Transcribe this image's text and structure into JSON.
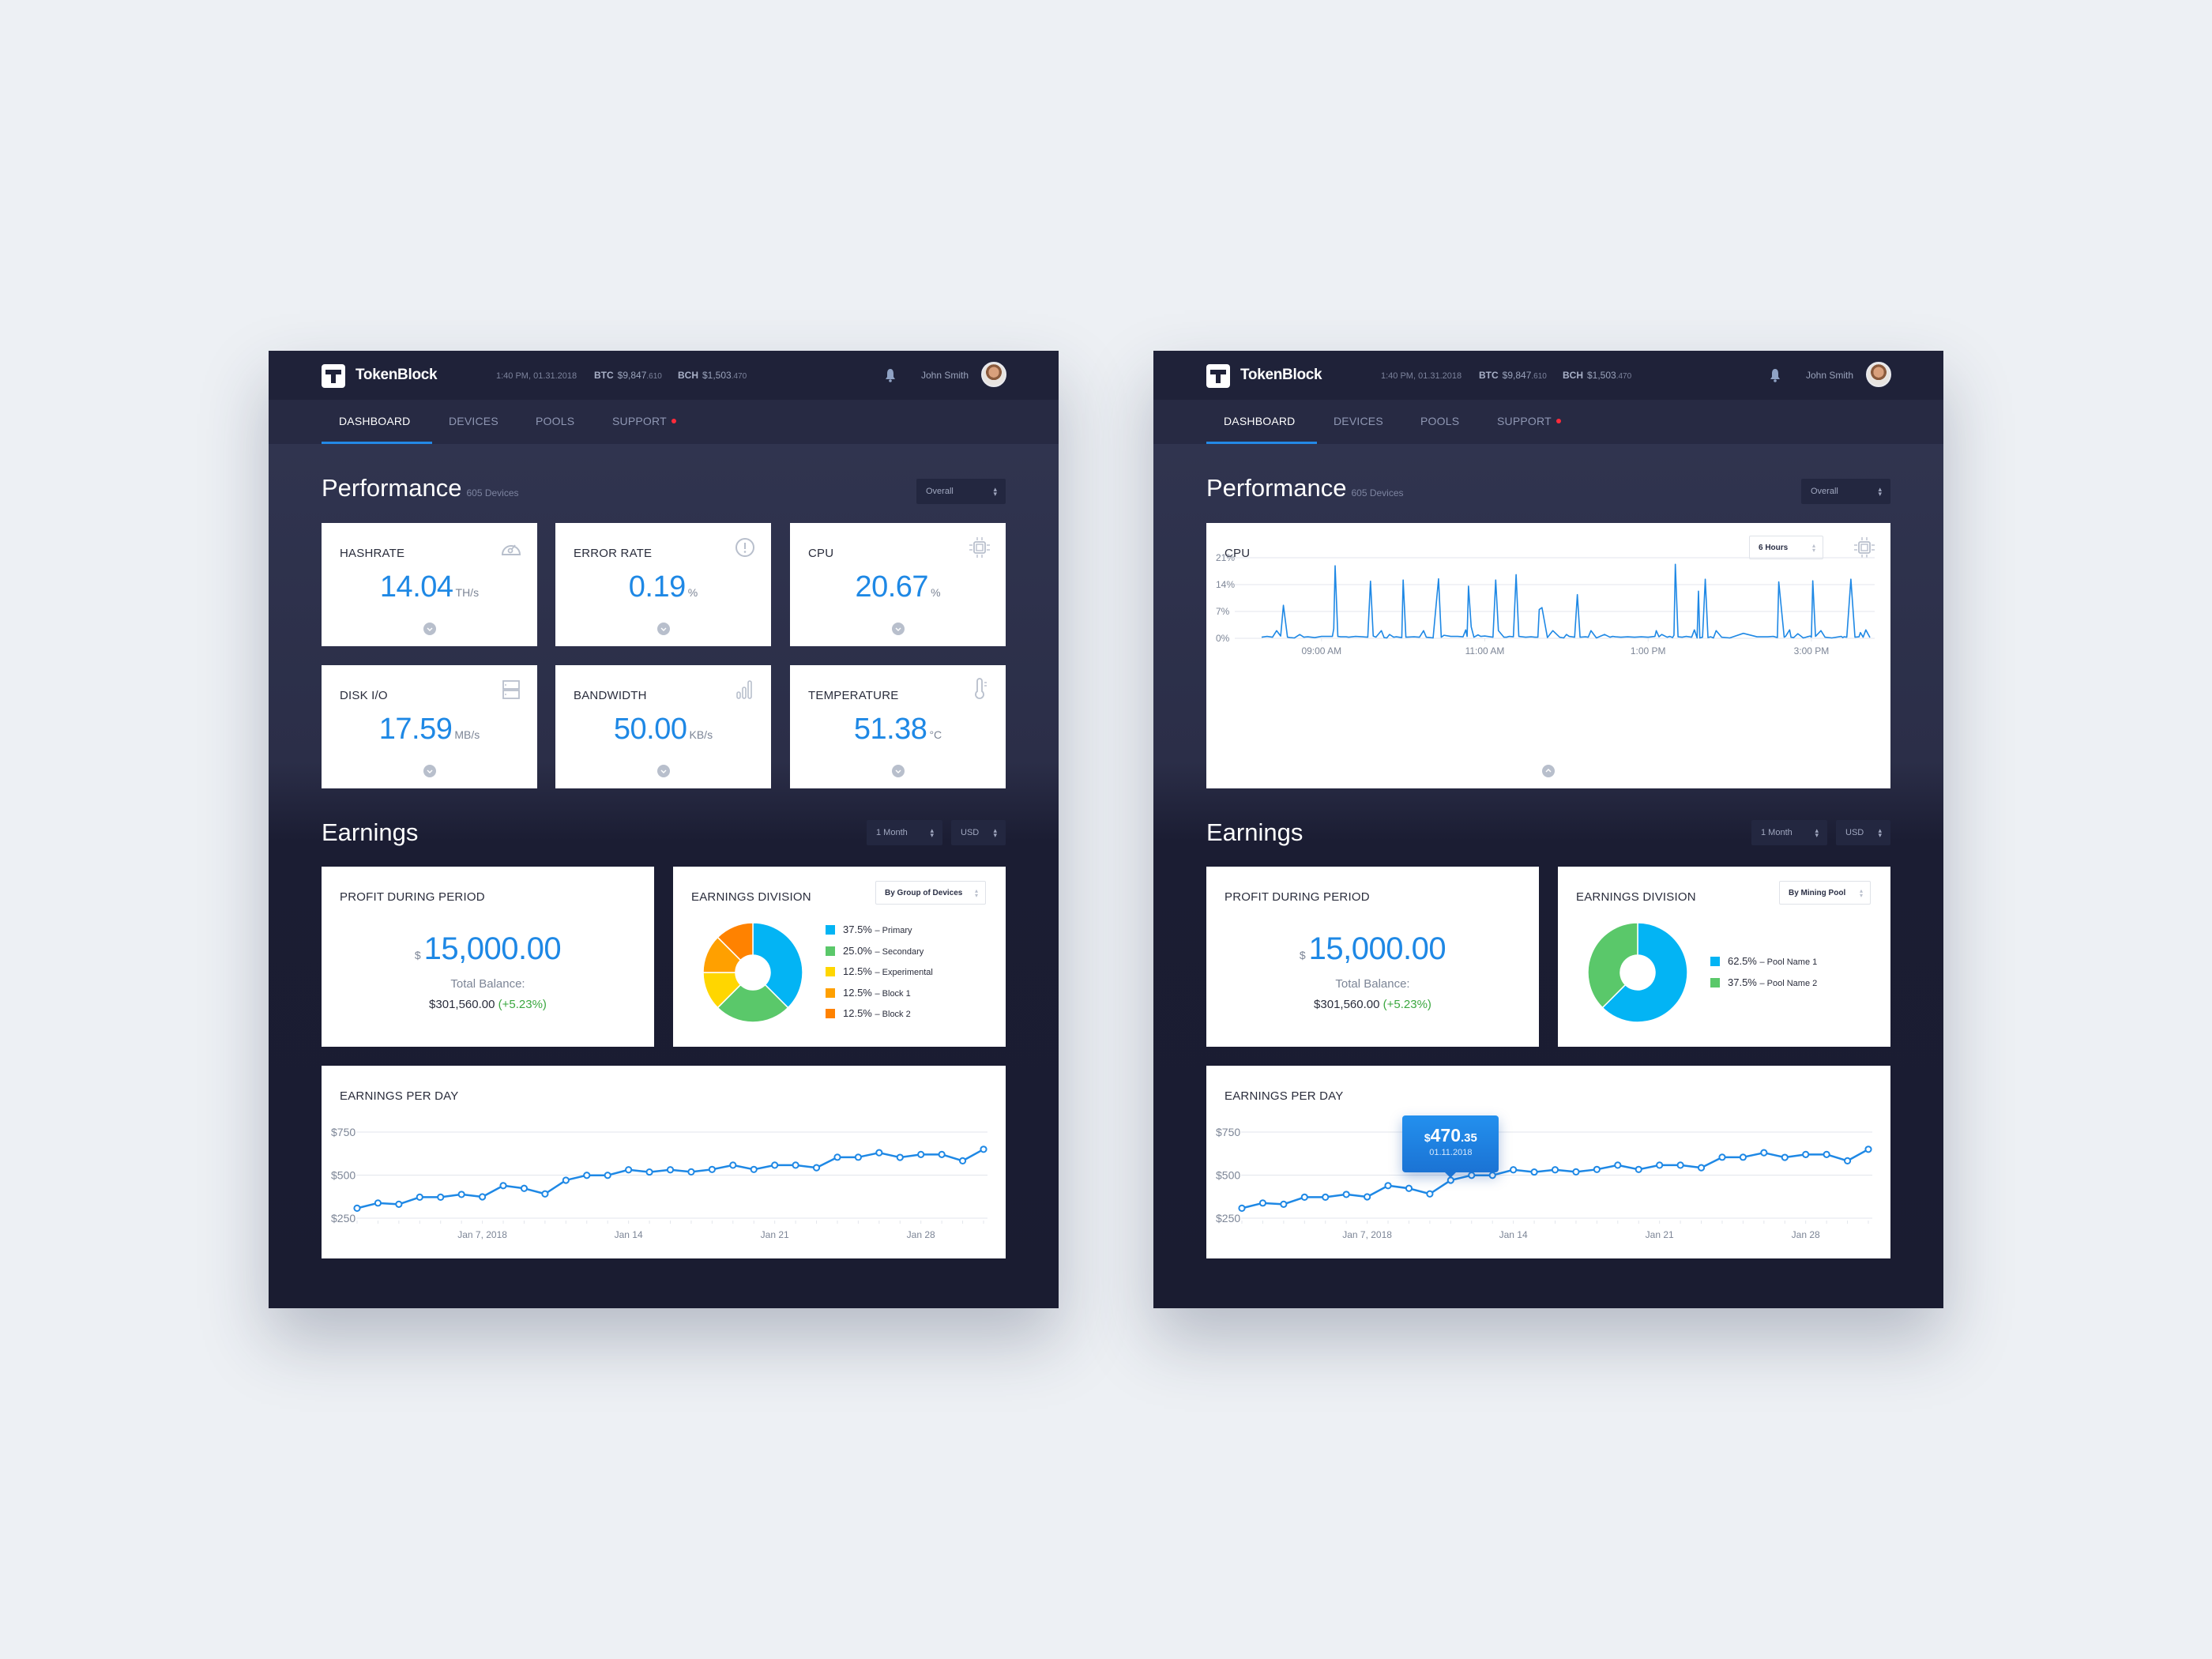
{
  "app": {
    "brand": "TokenBlock",
    "timestamp": "1:40 PM, 01.31.2018",
    "tickers": [
      {
        "symbol": "BTC",
        "price_main": "$9,847",
        "price_dec": ".610"
      },
      {
        "symbol": "BCH",
        "price_main": "$1,503",
        "price_dec": ".470"
      }
    ],
    "user_name": "John Smith",
    "nav": [
      {
        "label": "DASHBOARD",
        "active": true
      },
      {
        "label": "DEVICES",
        "active": false
      },
      {
        "label": "POOLS",
        "active": false
      },
      {
        "label": "SUPPORT",
        "active": false,
        "badge": "red-dot"
      }
    ],
    "colors": {
      "accent": "#1e88e5",
      "nav_active": "#2389e6",
      "badge": "#ff2b3a",
      "positive": "#3aa73f"
    }
  },
  "performance": {
    "title": "Performance",
    "subtitle": "605 Devices",
    "filter": "Overall",
    "metrics": [
      {
        "label": "HASHRATE",
        "value": "14.04",
        "unit": "TH/s",
        "icon": "speedometer-icon"
      },
      {
        "label": "ERROR RATE",
        "value": "0.19",
        "unit": "%",
        "icon": "alert-circle-icon"
      },
      {
        "label": "CPU",
        "value": "20.67",
        "unit": "%",
        "icon": "cpu-chip-icon"
      },
      {
        "label": "DISK I/O",
        "value": "17.59",
        "unit": "MB/s",
        "icon": "server-icon"
      },
      {
        "label": "BANDWIDTH",
        "value": "50.00",
        "unit": "KB/s",
        "icon": "signal-bars-icon"
      },
      {
        "label": "TEMPERATURE",
        "value": "51.38",
        "unit": "°C",
        "icon": "thermometer-icon"
      }
    ],
    "cpu_detail": {
      "label": "CPU",
      "range": "6 Hours"
    }
  },
  "earnings": {
    "title": "Earnings",
    "period": "1 Month",
    "currency": "USD",
    "profit": {
      "label": "PROFIT DURING PERIOD",
      "currency_symbol": "$",
      "value": "15,000.00",
      "balance_label": "Total Balance:",
      "balance": "$301,560.00",
      "change": "(+5.23%)"
    },
    "division_label": "EARNINGS DIVISION",
    "division_left_filter": "By Group of Devices",
    "division_right_filter": "By Mining Pool",
    "per_day_label": "EARNINGS PER DAY",
    "tooltip": {
      "currency": "$",
      "whole": "470",
      "decimals": ".35",
      "date": "01.11.2018"
    }
  },
  "chart_data": [
    {
      "id": "cpu-usage",
      "type": "line",
      "title": "CPU",
      "xlabel": "",
      "ylabel": "",
      "ylim": [
        0,
        21
      ],
      "yticks": [
        "0%",
        "7%",
        "14%",
        "21%"
      ],
      "ytick_values": [
        0,
        7,
        14,
        21
      ],
      "xticks": [
        "09:00 AM",
        "11:00 AM",
        "1:00 PM",
        "3:00 PM"
      ],
      "xtick_minutes": [
        540,
        660,
        780,
        900
      ],
      "xlim_minutes": [
        496,
        943
      ],
      "grid": true,
      "series": [
        {
          "name": "CPU %",
          "color": "#1e88e5",
          "minutes": [
            496,
            500,
            504,
            507,
            510,
            512,
            515,
            517,
            520,
            524,
            527,
            530,
            535,
            540,
            545,
            548,
            549,
            550,
            552,
            554,
            558,
            560,
            565,
            570,
            574,
            576,
            578,
            580,
            584,
            586,
            588,
            590,
            593,
            595,
            599,
            600,
            602,
            608,
            612,
            615,
            617,
            620,
            622,
            626,
            628,
            630,
            635,
            640,
            644,
            646,
            647,
            648,
            650,
            652,
            655,
            657,
            660,
            664,
            666,
            668,
            670,
            674,
            676,
            678,
            681,
            683,
            685,
            690,
            694,
            697,
            699,
            700,
            702,
            706,
            710,
            715,
            718,
            720,
            722,
            724,
            726,
            728,
            730,
            734,
            736,
            738,
            742,
            748,
            752,
            754,
            756,
            760,
            765,
            770,
            775,
            780,
            785,
            786,
            788,
            790,
            794,
            796,
            798,
            799,
            800,
            802,
            805,
            808,
            812,
            814,
            816,
            817,
            818,
            820,
            822,
            824,
            826,
            828,
            830,
            834,
            840,
            850,
            860,
            868,
            872,
            874,
            875,
            876,
            880,
            881,
            884,
            885,
            887,
            890,
            894,
            897,
            899,
            900,
            901,
            903,
            907,
            910,
            915,
            922,
            923,
            924,
            926,
            929,
            932,
            935,
            936,
            938,
            940,
            943
          ],
          "values": [
            0.3,
            0.5,
            0.3,
            2.0,
            0.6,
            8.6,
            0.3,
            0.2,
            0.1,
            1.0,
            0.3,
            0.4,
            0.2,
            0.5,
            0.5,
            0.5,
            2.5,
            18.9,
            0.5,
            0.4,
            0.4,
            0.3,
            0.5,
            0.4,
            0.3,
            14.9,
            0.6,
            0.3,
            2.0,
            0.2,
            0.1,
            1.0,
            0.3,
            0.4,
            0.2,
            15.2,
            0.3,
            0.4,
            0.3,
            2.0,
            0.3,
            0.2,
            0.1,
            15.5,
            0.3,
            0.8,
            0.5,
            0.5,
            0.4,
            2.2,
            0.5,
            13.6,
            3.0,
            0.3,
            0.9,
            0.5,
            0.6,
            0.4,
            0.3,
            15.2,
            2.0,
            0.3,
            0.3,
            0.5,
            0.4,
            16.6,
            0.5,
            0.3,
            0.4,
            0.3,
            0.3,
            7.5,
            8.0,
            0.2,
            2.0,
            0.3,
            0.1,
            1.0,
            0.5,
            0.4,
            0.3,
            11.4,
            0.3,
            0.4,
            0.3,
            2.0,
            0.1,
            1.0,
            0.3,
            0.5,
            0.4,
            0.3,
            0.4,
            0.3,
            0.4,
            0.3,
            0.5,
            2.0,
            0.4,
            1.0,
            0.3,
            0.5,
            0.2,
            0.8,
            19.3,
            0.4,
            0.3,
            0.5,
            0.3,
            2.2,
            0.1,
            12.3,
            0.1,
            0.3,
            15.4,
            0.2,
            0.4,
            0.1,
            2.0,
            0.3,
            0.1,
            1.3,
            0.4,
            0.4,
            0.5,
            0.3,
            0.2,
            14.7,
            0.3,
            0.5,
            2.2,
            0.3,
            0.2,
            1.2,
            0.1,
            0.4,
            0.6,
            0.3,
            15.0,
            0.5,
            2.0,
            0.3,
            0.1,
            0.5,
            0.2,
            0.4,
            0.3,
            15.4,
            0.3,
            0.4,
            1.5,
            0.3,
            2.2,
            0.2,
            0.4,
            20.5
          ]
        }
      ]
    },
    {
      "id": "earnings-division-groups",
      "type": "pie",
      "title": "EARNINGS DIVISION",
      "donut": true,
      "series": [
        {
          "name": "Primary",
          "value": 37.5,
          "label": "37.5%",
          "color": "#03b4f4"
        },
        {
          "name": "Secondary",
          "value": 25.0,
          "label": "25.0%",
          "color": "#5ac86a"
        },
        {
          "name": "Experimental",
          "value": 12.5,
          "label": "12.5%",
          "color": "#ffd600"
        },
        {
          "name": "Block 1",
          "value": 12.5,
          "label": "12.5%",
          "color": "#ffa000"
        },
        {
          "name": "Block 2",
          "value": 12.5,
          "label": "12.5%",
          "color": "#ff8200"
        }
      ]
    },
    {
      "id": "earnings-division-pools",
      "type": "pie",
      "title": "EARNINGS DIVISION",
      "donut": true,
      "series": [
        {
          "name": "Pool Name 1",
          "value": 62.5,
          "label": "62.5%",
          "color": "#03b4f4"
        },
        {
          "name": "Pool Name 2",
          "value": 37.5,
          "label": "37.5%",
          "color": "#5ac86a"
        }
      ]
    },
    {
      "id": "earnings-per-day",
      "type": "line",
      "title": "EARNINGS PER DAY",
      "xlabel": "",
      "ylabel": "",
      "ylim": [
        250,
        750
      ],
      "yticks": [
        "$250",
        "$500",
        "$750"
      ],
      "ytick_values": [
        250,
        500,
        750
      ],
      "xticks": [
        "Jan 7, 2018",
        "Jan 14",
        "Jan 21",
        "Jan 28"
      ],
      "xtick_days": [
        7,
        14,
        21,
        28
      ],
      "grid": true,
      "color": "#1e88e5",
      "days": [
        1,
        2,
        3,
        4,
        5,
        6,
        7,
        8,
        9,
        10,
        11,
        12,
        13,
        14,
        15,
        16,
        17,
        18,
        19,
        20,
        21,
        22,
        23,
        24,
        25,
        26,
        27,
        28,
        29,
        30,
        31
      ],
      "values": [
        308,
        338,
        331,
        372,
        372,
        388,
        374,
        439,
        423,
        391,
        470.35,
        499,
        499,
        531,
        518,
        531,
        519,
        533,
        558,
        533,
        558,
        558,
        543,
        604,
        604,
        630,
        603,
        620,
        620,
        583,
        650
      ]
    }
  ]
}
